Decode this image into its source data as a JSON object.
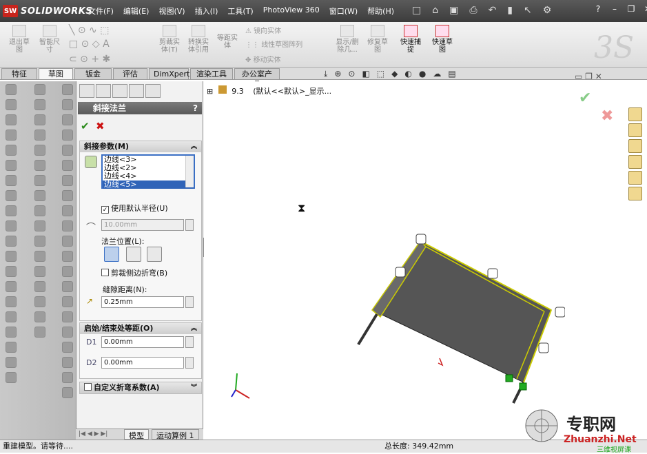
{
  "app": {
    "logo_badge": "SW",
    "name": "SOLIDWORKS"
  },
  "menu": [
    "文件(F)",
    "编辑(E)",
    "视图(V)",
    "插入(I)",
    "工具(T)",
    "PhotoView 360",
    "窗口(W)",
    "帮助(H)"
  ],
  "ribbon": {
    "exit_sketch": "退出草\n图",
    "smart_dim": "智能尺\n寸",
    "trim": "剪裁实\n体(T)",
    "convert": "转换实\n体引用",
    "offset": "等距实\n体",
    "mirror": "镜向实体",
    "linear_pattern": "线性草图阵列",
    "move": "移动实体",
    "show_delete": "显示/删\n除几...",
    "repair": "修复草\n图",
    "quick_snap": "快速捕\n捉",
    "rapid_sketch": "快速草\n图"
  },
  "tabs": [
    "特征",
    "草图",
    "钣金",
    "评估",
    "DimXpert",
    "渲染工具",
    "办公室产品"
  ],
  "selected_tab": "草图",
  "pm": {
    "title": "斜接法兰",
    "help": "?",
    "ok": "✔",
    "cancel": "✖",
    "group1_title": "斜接参数(M)",
    "edges": [
      "边线<3>",
      "边线<2>",
      "边线<4>",
      "边线<5>"
    ],
    "selected_edge": "边线<5>",
    "use_default_radius": "使用默认半径(U)",
    "radius_value": "10.00mm",
    "flange_position": "法兰位置(L):",
    "trim_side_bends": "剪裁侧边折弯(B)",
    "gap_distance": "缝隙距离(N):",
    "gap_value": "0.25mm",
    "group2_title": "启始/结束处等距(O)",
    "start_offset": "0.00mm",
    "end_offset": "0.00mm",
    "group3_title": "自定义折弯系数(A)"
  },
  "tree": {
    "expand": "⊞",
    "root": "9.3",
    "config": "(默认<<默认>_显示..."
  },
  "bottom_tabs": [
    "模型",
    "运动算例 1"
  ],
  "status": {
    "left": "重建模型。请等待....",
    "total_length": "总长度: 349.42mm"
  },
  "watermark": {
    "title": "专职网",
    "url": "Zhuanzhi.Net",
    "sub": "三维视屏课"
  }
}
